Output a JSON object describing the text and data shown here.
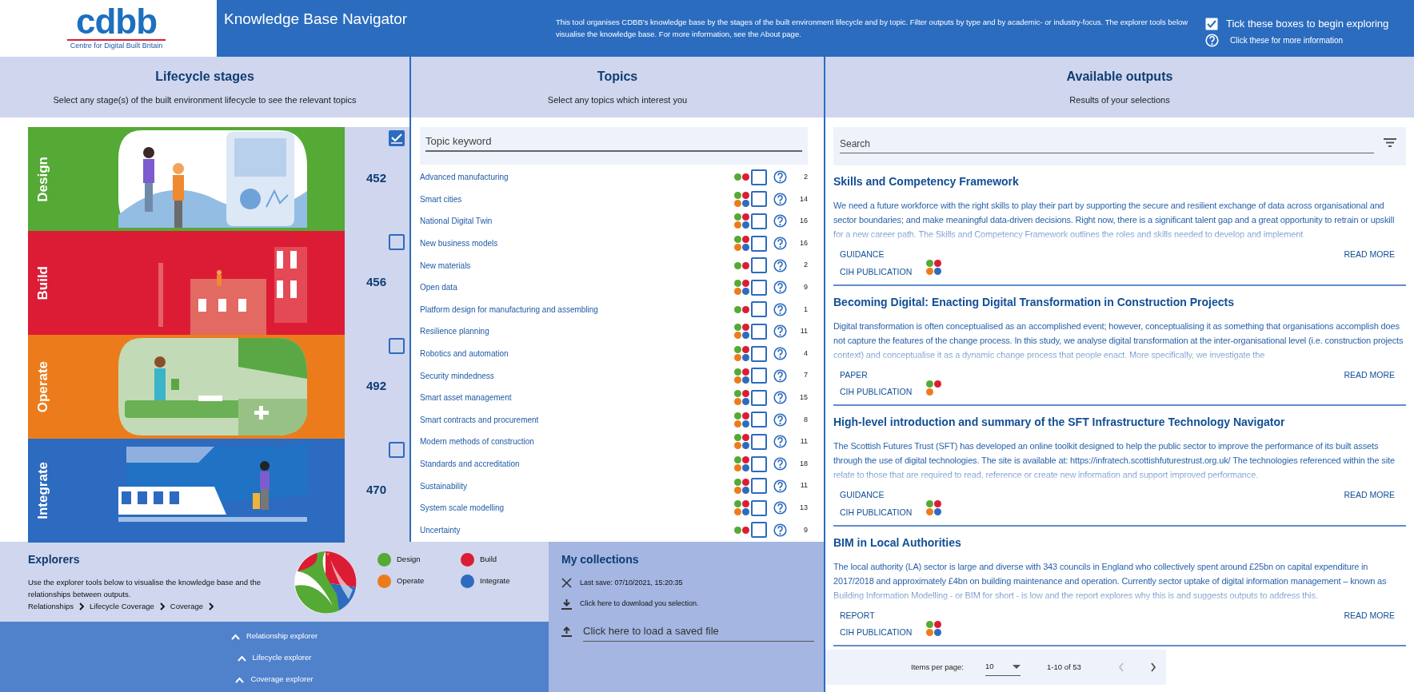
{
  "header": {
    "logo": "cdbb",
    "logo_subtitle": "Centre for Digital Built Britain",
    "title": "Knowledge Base Navigator",
    "description": "This tool organises CDBB’s knowledge base by the stages of the built environment lifecycle and by topic. Filter outputs by type and by academic- or industry-focus. The explorer tools below visualise the knowledge base. For more information, see the About page.",
    "hints": [
      {
        "kind": "tick",
        "text": "Tick these boxes to begin exploring"
      },
      {
        "kind": "help",
        "text": "Click these for more information"
      }
    ]
  },
  "lifecycle": {
    "title": "Lifecycle stages",
    "subtitle": "Select any stage(s) of the built environment lifecycle to see the relevant topics",
    "stages": [
      {
        "label": "Design",
        "count": "452",
        "checked": true,
        "color": "#55a935"
      },
      {
        "label": "Build",
        "count": "456",
        "checked": false,
        "color": "#dc1c35"
      },
      {
        "label": "Operate",
        "count": "492",
        "checked": false,
        "color": "#ec7c1b"
      },
      {
        "label": "Integrate",
        "count": "470",
        "checked": false,
        "color": "#2c6bbf"
      }
    ]
  },
  "topics": {
    "title": "Topics",
    "subtitle": "Select any topics which interest you",
    "search": {
      "placeholder": "Topic keyword"
    },
    "items": [
      {
        "name": "Advanced manufacturing",
        "dots": [
          {
            "color": "#55a935"
          },
          {
            "color": "#dc1c35"
          }
        ],
        "checked": false,
        "count": "2"
      },
      {
        "name": "Smart cities",
        "dots": [
          {
            "color": "#55a935"
          },
          {
            "color": "#dc1c35"
          },
          {
            "color": "#ec7c1b"
          },
          {
            "color": "#2c6bbf"
          }
        ],
        "checked": false,
        "count": "14"
      },
      {
        "name": "National Digital Twin",
        "dots": [
          {
            "color": "#55a935"
          },
          {
            "color": "#dc1c35"
          },
          {
            "color": "#ec7c1b"
          },
          {
            "color": "#2c6bbf"
          }
        ],
        "checked": false,
        "count": "16"
      },
      {
        "name": "New business models",
        "dots": [
          {
            "color": "#55a935"
          },
          {
            "color": "#dc1c35"
          },
          {
            "color": "#ec7c1b"
          },
          {
            "color": "#2c6bbf"
          }
        ],
        "checked": false,
        "count": "16"
      },
      {
        "name": "New materials",
        "dots": [
          {
            "color": "#55a935"
          },
          {
            "color": "#dc1c35"
          }
        ],
        "checked": false,
        "count": "2"
      },
      {
        "name": "Open data",
        "dots": [
          {
            "color": "#55a935"
          },
          {
            "color": "#dc1c35"
          },
          {
            "color": "#ec7c1b"
          },
          {
            "color": "#2c6bbf"
          }
        ],
        "checked": false,
        "count": "9"
      },
      {
        "name": "Platform design for manufacturing and assembling",
        "dots": [
          {
            "color": "#55a935"
          },
          {
            "color": "#dc1c35"
          }
        ],
        "checked": false,
        "count": "1"
      },
      {
        "name": "Resilience planning",
        "dots": [
          {
            "color": "#55a935"
          },
          {
            "color": "#dc1c35"
          },
          {
            "color": "#ec7c1b"
          },
          {
            "color": "#2c6bbf"
          }
        ],
        "checked": false,
        "count": "11"
      },
      {
        "name": "Robotics and automation",
        "dots": [
          {
            "color": "#55a935"
          },
          {
            "color": "#dc1c35"
          },
          {
            "color": "#ec7c1b"
          },
          {
            "color": "#2c6bbf"
          }
        ],
        "checked": false,
        "count": "4"
      },
      {
        "name": "Security mindedness",
        "dots": [
          {
            "color": "#55a935"
          },
          {
            "color": "#dc1c35"
          },
          {
            "color": "#ec7c1b"
          },
          {
            "color": "#2c6bbf"
          }
        ],
        "checked": false,
        "count": "7"
      },
      {
        "name": "Smart asset management",
        "dots": [
          {
            "color": "#55a935"
          },
          {
            "color": "#dc1c35"
          },
          {
            "color": "#ec7c1b"
          },
          {
            "color": "#2c6bbf"
          }
        ],
        "checked": false,
        "count": "15"
      },
      {
        "name": "Smart contracts and procurement",
        "dots": [
          {
            "color": "#55a935"
          },
          {
            "color": "#dc1c35"
          },
          {
            "color": "#ec7c1b"
          },
          {
            "color": "#2c6bbf"
          }
        ],
        "checked": false,
        "count": "8"
      },
      {
        "name": "Modern methods of construction",
        "dots": [
          {
            "color": "#55a935"
          },
          {
            "color": "#dc1c35"
          },
          {
            "color": "#ec7c1b"
          },
          {
            "color": "#2c6bbf"
          }
        ],
        "checked": false,
        "count": "11"
      },
      {
        "name": "Standards and accreditation",
        "dots": [
          {
            "color": "#55a935"
          },
          {
            "color": "#dc1c35"
          },
          {
            "color": "#ec7c1b"
          },
          {
            "color": "#2c6bbf"
          }
        ],
        "checked": false,
        "count": "18"
      },
      {
        "name": "Sustainability",
        "dots": [
          {
            "color": "#55a935"
          },
          {
            "color": "#dc1c35"
          },
          {
            "color": "#ec7c1b"
          },
          {
            "color": "#2c6bbf"
          }
        ],
        "checked": false,
        "count": "11"
      },
      {
        "name": "System scale modelling",
        "dots": [
          {
            "color": "#55a935"
          },
          {
            "color": "#dc1c35"
          },
          {
            "color": "#ec7c1b"
          },
          {
            "color": "#2c6bbf"
          }
        ],
        "checked": false,
        "count": "13"
      },
      {
        "name": "Uncertainty",
        "dots": [
          {
            "color": "#55a935"
          },
          {
            "color": "#dc1c35"
          }
        ],
        "checked": false,
        "count": "9"
      }
    ]
  },
  "outputs": {
    "title": "Available outputs",
    "subtitle": "Results of your selections",
    "search": {
      "placeholder": "Search"
    },
    "items": [
      {
        "title": "Skills and Competency Framework",
        "summary": "We need a future workforce with the right skills to play their part by supporting the secure and resilient exchange of data across organisational and sector boundaries; and make meaningful data-driven decisions. Right now, there is a significant talent gap and a great opportunity to retrain or upskill for a new career path. The Skills and Competency Framework outlines the roles and skills needed to develop and implement",
        "type": "GUIDANCE",
        "publisher": "CIH PUBLICATION",
        "dots": [
          {
            "color": "#55a935"
          },
          {
            "color": "#dc1c35"
          },
          {
            "color": "#ec7c1b"
          },
          {
            "color": "#2c6bbf"
          }
        ],
        "action": "READ MORE"
      },
      {
        "title": "Becoming Digital: Enacting Digital Transformation in Construction Projects",
        "summary": "Digital transformation is often conceptualised as an accomplished event; however, conceptualising it as something that organisations accomplish does not capture the features of the change process. In this study, we analyse digital transformation at the inter-organisational level (i.e. construction projects context) and conceptualise it as a dynamic change process that people enact. More specifically, we investigate the",
        "type": "PAPER",
        "publisher": "CIH PUBLICATION",
        "dots": [
          {
            "color": "#55a935"
          },
          {
            "color": "#dc1c35"
          },
          {
            "color": "#ec7c1b"
          }
        ],
        "action": "READ MORE"
      },
      {
        "title": "High-level introduction and summary of the SFT Infrastructure Technology Navigator",
        "summary": "The Scottish Futures Trust (SFT) has developed an online toolkit designed to help the public sector to improve the performance of its built assets through the use of digital technologies. The site is available at: https://infratech.scottishfuturestrust.org.uk/ The technologies referenced within the site relate to those that are required to read, reference or create new information and support improved performance.",
        "type": "GUIDANCE",
        "publisher": "CIH PUBLICATION",
        "dots": [
          {
            "color": "#55a935"
          },
          {
            "color": "#dc1c35"
          },
          {
            "color": "#ec7c1b"
          },
          {
            "color": "#2c6bbf"
          }
        ],
        "action": "READ MORE"
      },
      {
        "title": "BIM in Local Authorities",
        "summary": "The local authority (LA) sector is large and diverse with 343 councils in England who collectively spent around £25bn on capital expenditure in 2017/2018 and approximately £4bn on building maintenance and operation. Currently sector uptake of digital information management – known as Building Information Modelling - or BIM for short - is low and the report explores why this is and suggests outputs to address this.",
        "type": "REPORT",
        "publisher": "CIH PUBLICATION",
        "dots": [
          {
            "color": "#55a935"
          },
          {
            "color": "#dc1c35"
          },
          {
            "color": "#ec7c1b"
          },
          {
            "color": "#2c6bbf"
          }
        ],
        "action": "READ MORE"
      }
    ],
    "pagination": {
      "label": "Items per page:",
      "page_size": "10",
      "range": "1-10 of 53",
      "prev_disabled": true,
      "next_disabled": false
    }
  },
  "explorers": {
    "title": "Explorers",
    "description": "Use the explorer tools below to visualise the knowledge base and the relationships between outputs.",
    "links": [
      "Relationships",
      "Lifecycle Coverage",
      "Coverage"
    ],
    "legend": [
      {
        "label": "Design",
        "color": "#55a935"
      },
      {
        "label": "Build",
        "color": "#dc1c35"
      },
      {
        "label": "Operate",
        "color": "#ec7c1b"
      },
      {
        "label": "Integrate",
        "color": "#2c6bbf"
      }
    ],
    "tools": [
      "Relationship explorer",
      "Lifecycle explorer",
      "Coverage explorer"
    ]
  },
  "collections": {
    "title": "My collections",
    "actions": [
      {
        "kind": "clear",
        "text": "Last save: 07/10/2021, 15:20:35"
      },
      {
        "kind": "download",
        "text": "Click here to download you selection."
      }
    ],
    "load": {
      "placeholder": "Click here to load a saved file"
    }
  }
}
